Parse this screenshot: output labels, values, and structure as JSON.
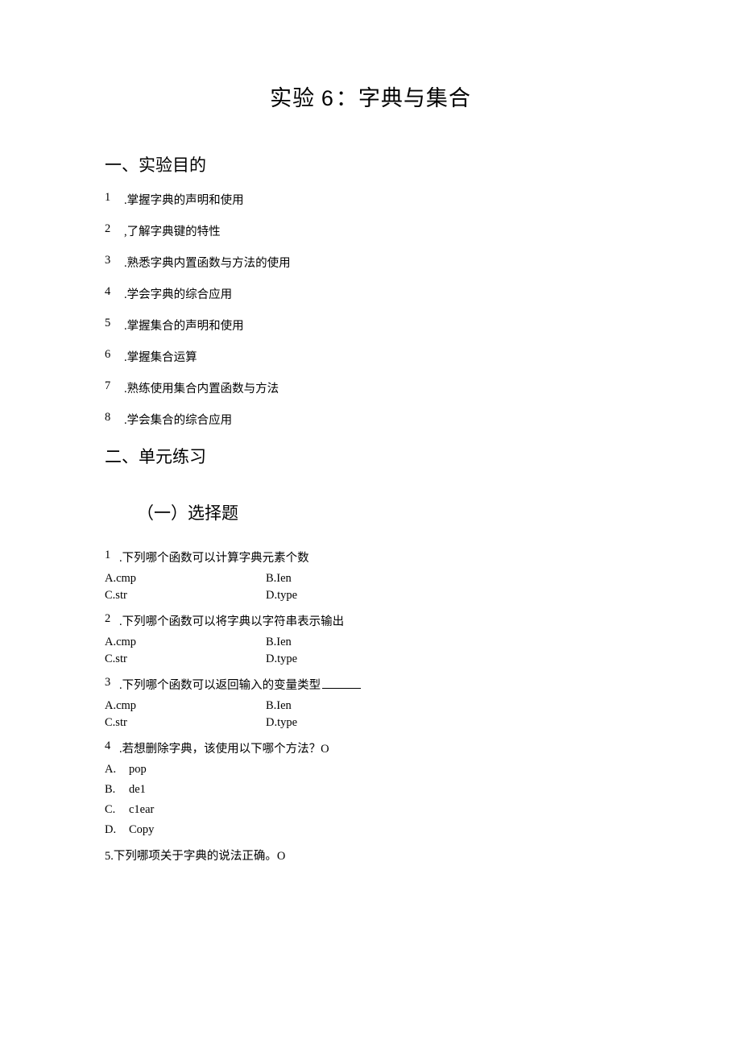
{
  "title_prefix": "实验 ",
  "title_number": "6",
  "title_suffix": "：字典与集合",
  "section1_heading": "一、实验目的",
  "objectives": [
    {
      "n": "1",
      "t": ".掌握字典的声明和使用"
    },
    {
      "n": "2",
      "t": ",了解字典键的特性"
    },
    {
      "n": "3",
      "t": ".熟悉字典内置函数与方法的使用"
    },
    {
      "n": "4",
      "t": ".学会字典的综合应用"
    },
    {
      "n": "5",
      "t": ".掌握集合的声明和使用"
    },
    {
      "n": "6",
      "t": ".掌握集合运算"
    },
    {
      "n": "7",
      "t": ".熟练使用集合内置函数与方法"
    },
    {
      "n": "8",
      "t": ".学会集合的综合应用"
    }
  ],
  "section2_heading": "二、单元练习",
  "subsection_heading": "（一）选择题",
  "q1": {
    "n": "1",
    "stem": ".下列哪个函数可以计算字典元素个数",
    "a": "A.cmp",
    "b": "B.Ien",
    "c": "C.str",
    "d": "D.type"
  },
  "q2": {
    "n": "2",
    "stem": ".下列哪个函数可以将字典以字符串表示输出",
    "a": "A.cmp",
    "b": "B.Ien",
    "c": "C.str",
    "d": "D.type"
  },
  "q3": {
    "n": "3",
    "stem": ".下列哪个函数可以返回输入的变量类型",
    "a": "A.cmp",
    "b": "B.Ien",
    "c": "C.str",
    "d": "D.type"
  },
  "q4": {
    "n": "4",
    "stem": ".若想删除字典，该使用以下哪个方法？O",
    "a_lbl": "A.",
    "a_txt": "pop",
    "b_lbl": "B.",
    "b_txt": "de1",
    "c_lbl": "C.",
    "c_txt": "c1ear",
    "d_lbl": "D.",
    "d_txt": "Copy"
  },
  "q5": {
    "stem": "5.下列哪项关于字典的说法正确。O"
  }
}
